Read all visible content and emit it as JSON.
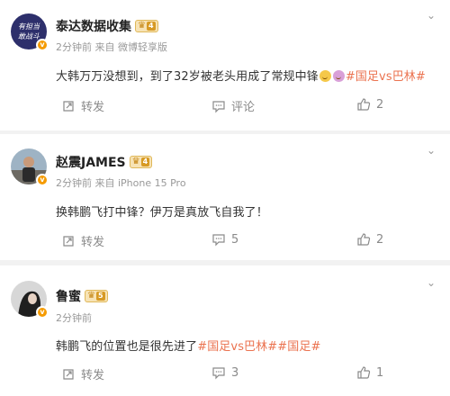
{
  "comments": [
    {
      "name": "泰达数据收集",
      "level": "4",
      "meta": "2分钟前 来自 微博轻享版",
      "text_plain": "大韩万万没想到，到了32岁被老头用成了常规中锋",
      "tag": "#国足vs巴林#",
      "forward_label": "转发",
      "comment_label": "评论",
      "like_count": "2",
      "avatar_text": "有担当 敢战斗"
    },
    {
      "name": "赵震JAMES",
      "level": "4",
      "meta": "2分钟前 来自 iPhone 15 Pro",
      "text_plain": "换韩鹏飞打中锋？伊万是真放飞自我了！",
      "forward_label": "转发",
      "comment_count": "5",
      "like_count": "2"
    },
    {
      "name": "鲁蜜",
      "level": "5",
      "meta": "2分钟前",
      "text_plain": "韩鹏飞的位置也是很先进了",
      "tag1": "#国足vs巴林#",
      "tag2": "#国足#",
      "forward_label": "转发",
      "comment_count": "3",
      "like_count": "1"
    }
  ],
  "colors": {
    "tag": "#eb7350",
    "badge": "#f59b00",
    "meta": "#999999"
  }
}
